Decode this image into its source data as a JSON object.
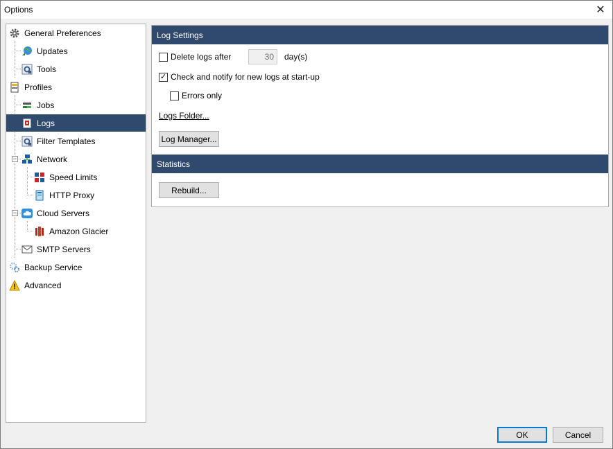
{
  "window": {
    "title": "Options",
    "close_glyph": "✕"
  },
  "tree": {
    "items": [
      {
        "label": "General Preferences",
        "icon": "gear-icon"
      },
      {
        "label": "Updates",
        "icon": "globe-update-icon"
      },
      {
        "label": "Tools",
        "icon": "tools-icon"
      },
      {
        "label": "Profiles",
        "icon": "profiles-icon"
      },
      {
        "label": "Jobs",
        "icon": "jobs-icon"
      },
      {
        "label": "Logs",
        "icon": "logs-icon",
        "selected": true
      },
      {
        "label": "Filter Templates",
        "icon": "filter-icon"
      },
      {
        "label": "Network",
        "icon": "network-icon"
      },
      {
        "label": "Speed Limits",
        "icon": "speed-limits-icon"
      },
      {
        "label": "HTTP Proxy",
        "icon": "http-proxy-icon"
      },
      {
        "label": "Cloud Servers",
        "icon": "cloud-icon"
      },
      {
        "label": "Amazon Glacier",
        "icon": "amazon-glacier-icon"
      },
      {
        "label": "SMTP Servers",
        "icon": "envelope-icon"
      },
      {
        "label": "Backup Service",
        "icon": "gears-icon"
      },
      {
        "label": "Advanced",
        "icon": "warning-icon"
      }
    ]
  },
  "log_settings": {
    "header": "Log Settings",
    "delete_logs_label": "Delete logs after",
    "delete_logs_checked": false,
    "delete_days_value": "30",
    "days_unit": "day(s)",
    "notify_label": "Check and notify for new logs at start-up",
    "notify_checked": true,
    "errors_only_label": "Errors only",
    "errors_only_checked": false,
    "logs_folder_link": "Logs Folder...",
    "log_manager_button": "Log Manager..."
  },
  "statistics": {
    "header": "Statistics",
    "rebuild_button": "Rebuild..."
  },
  "footer": {
    "ok_label": "OK",
    "cancel_label": "Cancel"
  },
  "colors": {
    "selection": "#304a6e",
    "header_bg": "#304a6e",
    "window_bg": "#f0f0f0"
  }
}
